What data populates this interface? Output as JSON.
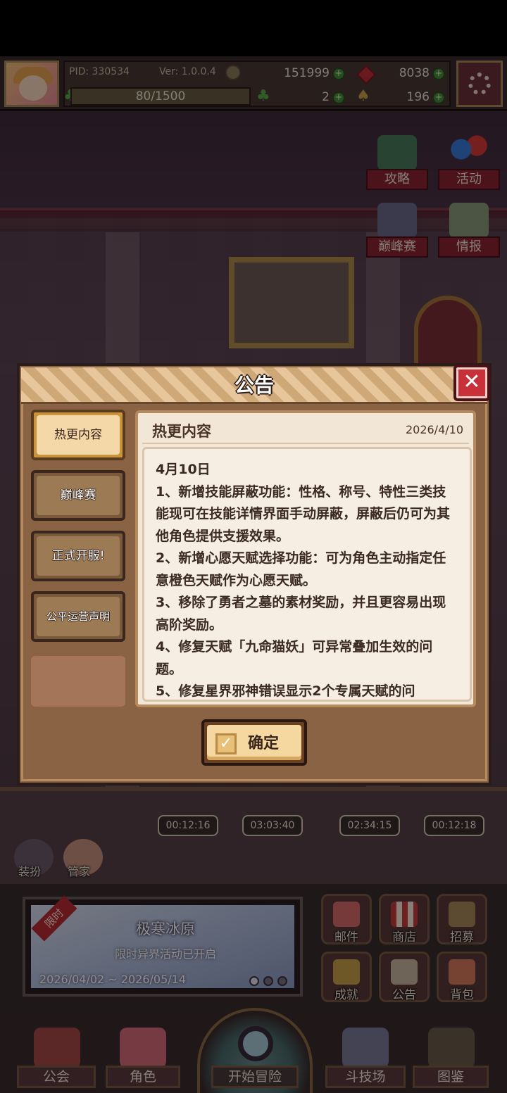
{
  "topbar": {
    "pid": "PID: 330534",
    "version": "Ver: 1.0.0.4",
    "gold": "151999",
    "gems": "8038",
    "stamina": "80/1500",
    "clover_count": "2",
    "key_count": "196"
  },
  "side_menu": [
    {
      "label": "攻略",
      "icon": "chat-icon"
    },
    {
      "label": "活动",
      "icon": "balloon-icon"
    },
    {
      "label": "巅峰赛",
      "icon": "swords-icon"
    },
    {
      "label": "情报",
      "icon": "map-icon"
    }
  ],
  "timers": [
    "00:12:16",
    "03:03:40",
    "02:34:15",
    "00:12:18"
  ],
  "mini_buttons": [
    "装扮",
    "管家"
  ],
  "event": {
    "ribbon": "限时",
    "title": "极寒冰原",
    "subtitle": "限时异界活动已开启",
    "dates": "2026/04/02 ~ 2026/05/14"
  },
  "grid_menu": [
    "邮件",
    "商店",
    "招募",
    "成就",
    "公告",
    "背包"
  ],
  "nav": {
    "guild": "公会",
    "character": "角色",
    "start": "开始冒险",
    "arena": "斗技场",
    "codex": "图鉴"
  },
  "dialog": {
    "title": "公告",
    "tabs": [
      "热更内容",
      "巅峰赛",
      "正式开服!",
      "公平运营声明"
    ],
    "content_title": "热更内容",
    "content_date": "2026/4/10",
    "paragraphs": [
      "4月10日",
      "1、新增技能屏蔽功能：性格、称号、特性三类技能现可在技能详情界面手动屏蔽，屏蔽后仍可为其他角色提供支援效果。",
      "2、新增心愿天赋选择功能：可为角色主动指定任意橙色天赋作为心愿天赋。",
      "3、移除了勇者之墓的素材奖励，并且更容易出现高阶奖励。",
      "4、修复天赋「九命猫妖」可异常叠加生效的问题。",
      "5、修复星界邪神错误显示2个专属天赋的问"
    ],
    "confirm_label": "确定"
  },
  "colors": {
    "accent_red": "#c8303a",
    "panel_brown": "#8a6244",
    "paper": "#f2e6d6"
  }
}
